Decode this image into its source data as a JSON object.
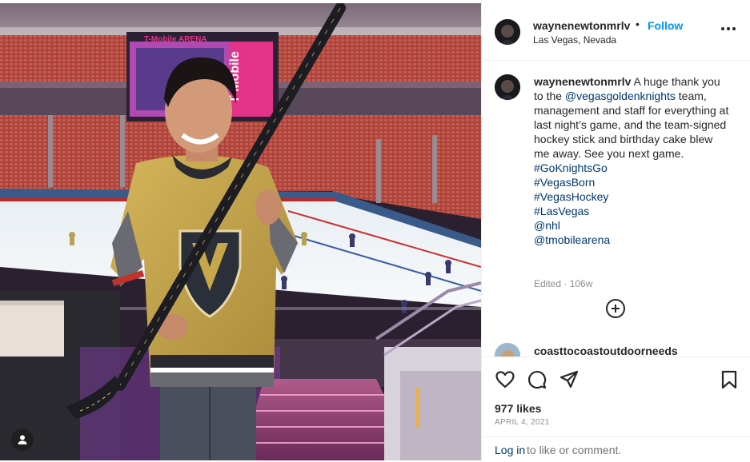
{
  "post": {
    "username": "waynenewtonmrlv",
    "dot": "•",
    "follow_label": "Follow",
    "location": "Las Vegas, Nevada",
    "arena_sign": "T-Mobile ARENA",
    "scoreboard_text": "T Mobile",
    "caption": {
      "username": "waynenewtonmrlv",
      "text_1": " A huge thank you to the ",
      "mention_1": "@vegasgoldenknights",
      "text_2": " team, management and staff for everything at last night’s game, and the team-signed hockey stick and birthday cake blew me away. See you next game.",
      "hashtags": [
        "#GoKnightsGo",
        "#VegasBorn",
        "#VegasHockey",
        "#LasVegas",
        "@nhl",
        "@tmobilearena"
      ],
      "edited_label": "Edited",
      "meta_dot": " · ",
      "age": "106w"
    },
    "next_comment_username": "coasttocoastoutdoorneeds",
    "likes": "977 likes",
    "date": "APRIL 4, 2021",
    "login_link": "Log in",
    "login_rest": " to like or comment.",
    "icons": {
      "more": "more-options-icon",
      "like": "heart-icon",
      "comment": "comment-icon",
      "share": "paper-plane-icon",
      "save": "bookmark-icon",
      "load_more": "plus-circle-icon",
      "user_tag": "user-tag-icon"
    },
    "colors": {
      "link_blue": "#0095f6",
      "mention_blue": "#00376b",
      "jersey_gold": "#c6a84a",
      "secondary_text": "#8e8e8e"
    }
  }
}
